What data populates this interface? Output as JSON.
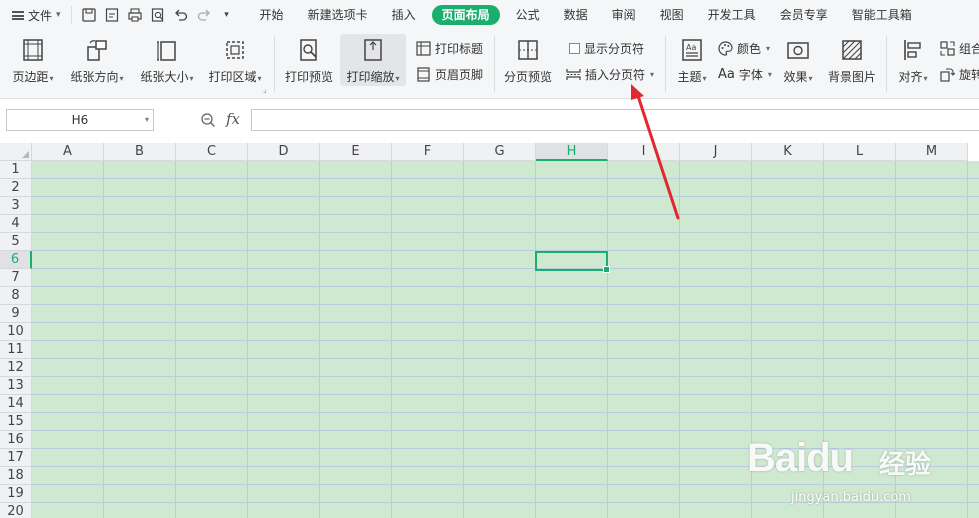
{
  "menubar": {
    "file_label": "文件",
    "tabs": [
      {
        "label": "开始"
      },
      {
        "label": "新建选项卡"
      },
      {
        "label": "插入"
      },
      {
        "label": "页面布局"
      },
      {
        "label": "公式"
      },
      {
        "label": "数据"
      },
      {
        "label": "审阅"
      },
      {
        "label": "视图"
      },
      {
        "label": "开发工具"
      },
      {
        "label": "会员专享"
      },
      {
        "label": "智能工具箱"
      }
    ],
    "active_tab": "页面布局"
  },
  "ribbon": {
    "margins": "页边距",
    "orientation": "纸张方向",
    "size": "纸张大小",
    "print_area": "打印区域",
    "print_preview": "打印预览",
    "print_scale": "打印缩放",
    "print_titles": "打印标题",
    "header_footer": "页眉页脚",
    "page_break_preview": "分页预览",
    "show_page_breaks": "显示分页符",
    "insert_page_break": "插入分页符",
    "theme": "主题",
    "colors": "颜色",
    "fonts": "字体",
    "fonts_prefix": "Aa",
    "effects": "效果",
    "background": "背景图片",
    "align": "对齐",
    "group": "组合",
    "rotate": "旋转"
  },
  "formula_bar": {
    "cell_ref": "H6",
    "fx": "fx",
    "value": ""
  },
  "grid": {
    "columns": [
      "A",
      "B",
      "C",
      "D",
      "E",
      "F",
      "G",
      "H",
      "I",
      "J",
      "K",
      "L",
      "M"
    ],
    "rows": [
      "1",
      "2",
      "3",
      "4",
      "5",
      "6",
      "7",
      "8",
      "9",
      "10",
      "11",
      "12",
      "13",
      "14",
      "15",
      "16",
      "17",
      "18",
      "19",
      "20"
    ],
    "selected_column": "H",
    "selected_row": "6"
  },
  "watermark": {
    "logo": "Baidu",
    "brand": "经验",
    "url": "jingyan.baidu.com"
  },
  "colors": {
    "accent": "#1aae6f",
    "cell_fill": "#cfe8d0",
    "arrow": "#e0282e"
  }
}
